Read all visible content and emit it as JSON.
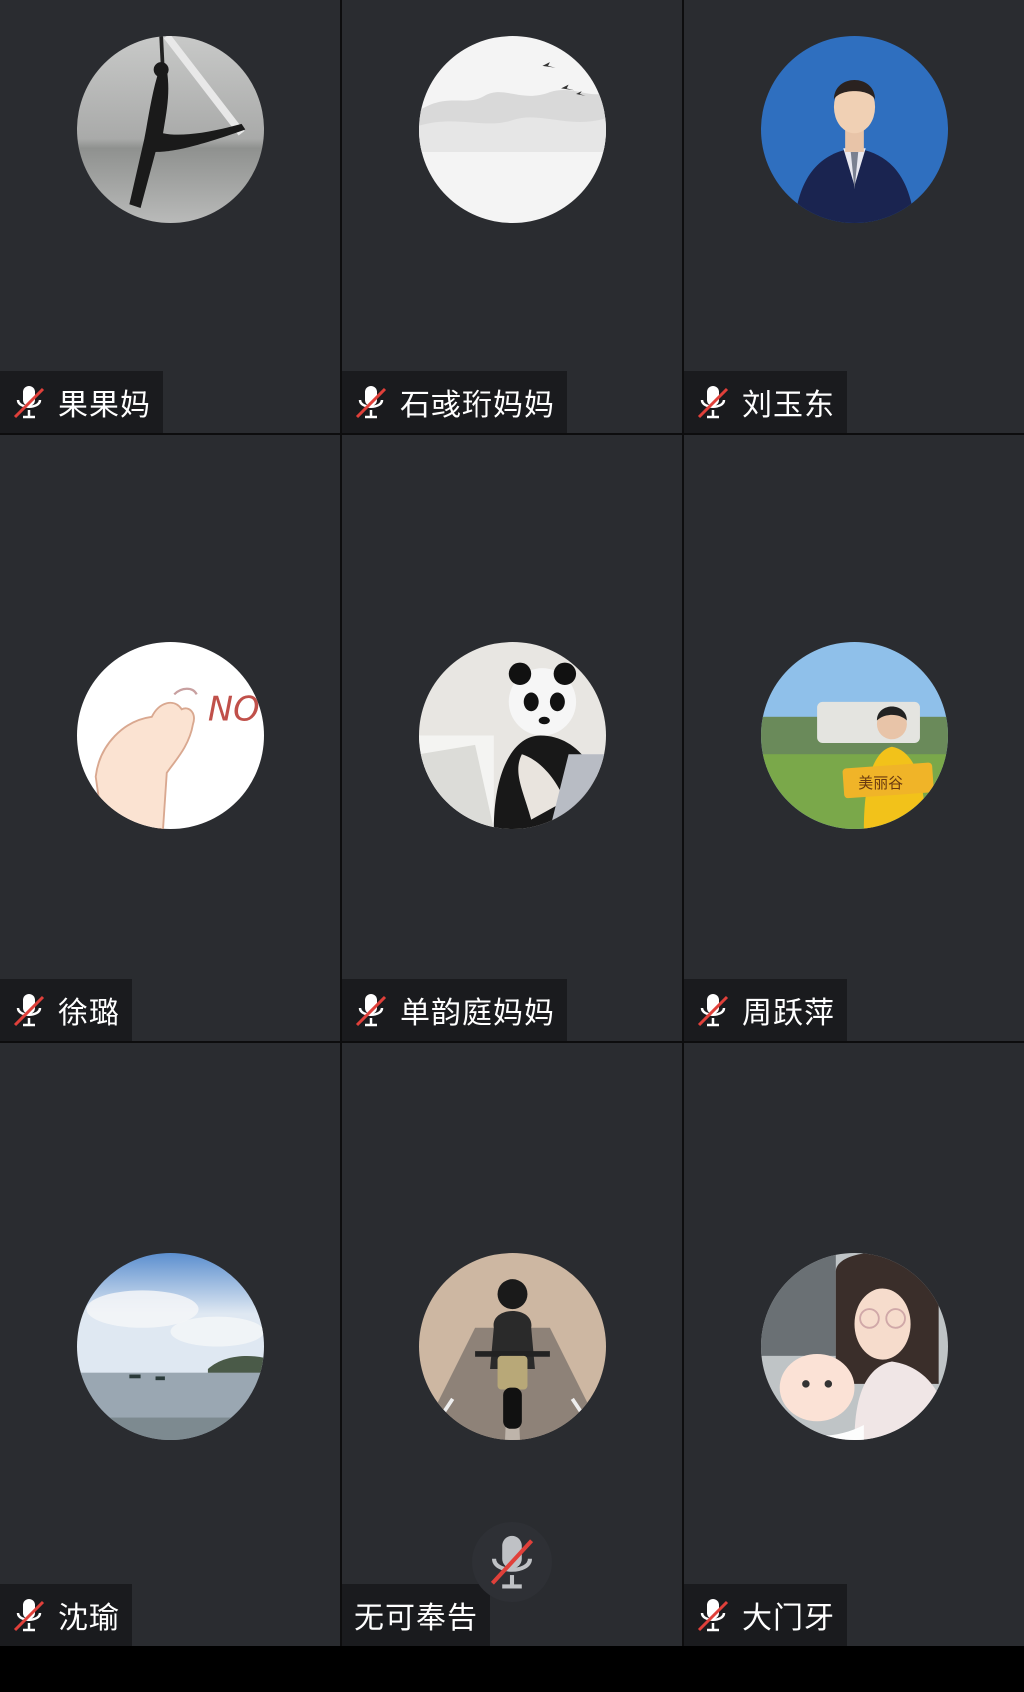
{
  "participants": [
    {
      "name": "果果妈",
      "muted": true,
      "avatar": "silhouette-dancer-avatar"
    },
    {
      "name": "石彧珩妈妈",
      "muted": true,
      "avatar": "ink-mountain-birds-avatar"
    },
    {
      "name": "刘玉东",
      "muted": true,
      "avatar": "man-in-suit-avatar"
    },
    {
      "name": "徐璐",
      "muted": true,
      "avatar": "hand-no-sticker-avatar"
    },
    {
      "name": "单韵庭妈妈",
      "muted": true,
      "avatar": "panda-plush-avatar"
    },
    {
      "name": "周跃萍",
      "muted": true,
      "avatar": "woman-with-sign-avatar"
    },
    {
      "name": "沈瑜",
      "muted": true,
      "avatar": "sea-sky-avatar"
    },
    {
      "name": "无可奉告",
      "muted": false,
      "avatar": "motorcycle-rider-avatar"
    },
    {
      "name": "大门牙",
      "muted": true,
      "avatar": "mother-baby-avatar"
    }
  ],
  "avatar_sign_text": "美丽谷",
  "avatar_doodle_text": "NO",
  "colors": {
    "tile": "#2a2c30",
    "label_bg": "#1a1b1e",
    "mute_slash": "#e0403a"
  }
}
